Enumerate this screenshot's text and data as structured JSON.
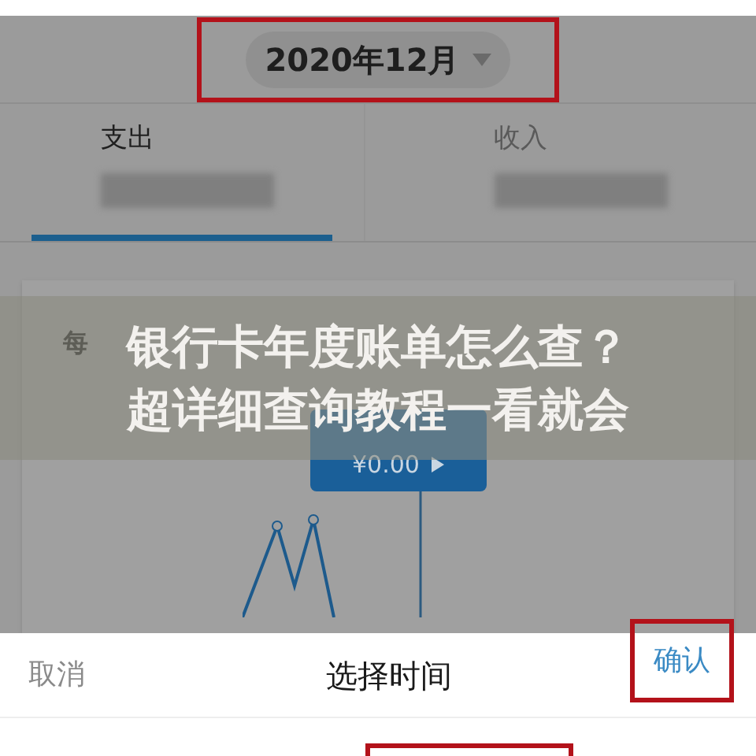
{
  "month_selector": {
    "label": "2020年12月"
  },
  "tabs": [
    {
      "label": "支出",
      "selected": true
    },
    {
      "label": "收入",
      "selected": false
    }
  ],
  "card": {
    "title": "每",
    "tooltip": {
      "amount": "¥0.00"
    }
  },
  "caption": [
    "银行卡年度账单怎么查？",
    "超详细查询教程一看就会"
  ],
  "sheet": {
    "cancel": "取消",
    "title": "选择时间",
    "confirm": "确认"
  }
}
